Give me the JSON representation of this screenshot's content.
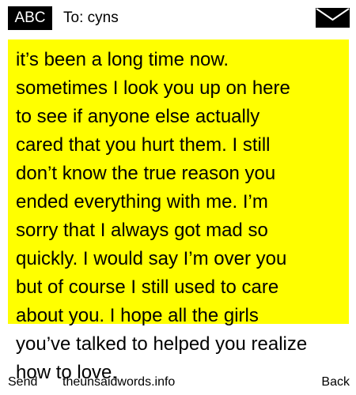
{
  "header": {
    "mode_label": "ABC",
    "recipient_text": "To: cyns",
    "envelope_icon": "envelope-icon"
  },
  "message": {
    "text": "it’s been a long time now.\nsometimes I look you up on here\nto see if anyone else actually\ncared that you hurt them. I still\ndon’t know the true reason you\nended everything with me. I’m\nsorry that I always got mad so\nquickly. I would say I’m over you\nbut of course I still used to care\nabout you. I hope all the girls\nyou’ve talked to helped you realize\nhow to love.",
    "highlight_color": "#ffff00"
  },
  "footer": {
    "send_label": "Send",
    "site_text": "theunsaidwords.info",
    "back_label": "Back"
  }
}
